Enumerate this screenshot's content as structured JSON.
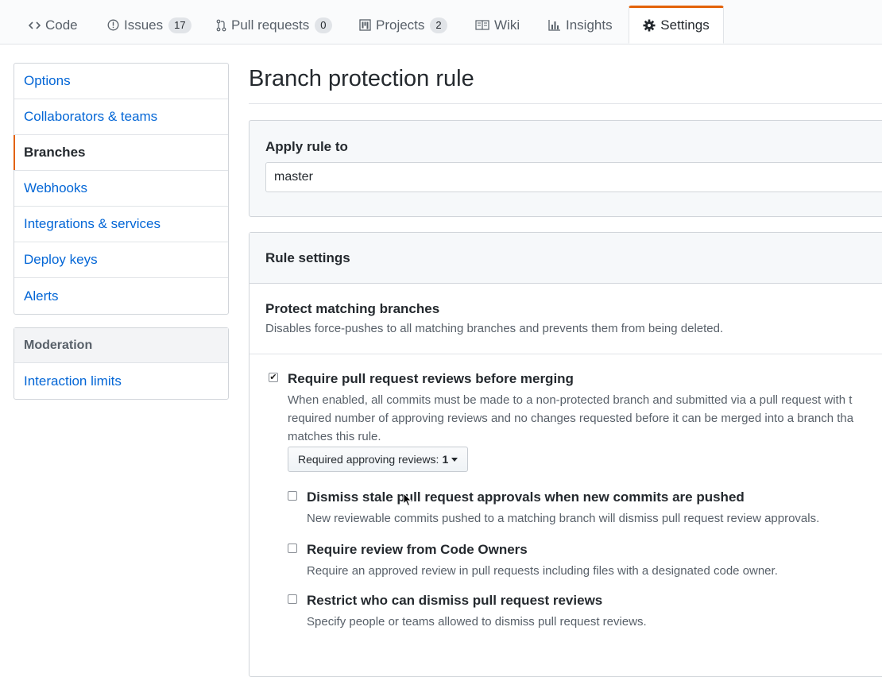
{
  "repo_nav": {
    "tabs": [
      {
        "label": "Code",
        "icon": "code-icon"
      },
      {
        "label": "Issues",
        "icon": "issue-opened-icon",
        "count": "17"
      },
      {
        "label": "Pull requests",
        "icon": "git-pull-request-icon",
        "count": "0"
      },
      {
        "label": "Projects",
        "icon": "project-icon",
        "count": "2"
      },
      {
        "label": "Wiki",
        "icon": "book-icon"
      },
      {
        "label": "Insights",
        "icon": "graph-icon"
      },
      {
        "label": "Settings",
        "icon": "gear-icon",
        "selected": true
      }
    ],
    "accent_color": "#e36209"
  },
  "sidebar": {
    "items": [
      {
        "label": "Options"
      },
      {
        "label": "Collaborators & teams"
      },
      {
        "label": "Branches",
        "selected": true
      },
      {
        "label": "Webhooks"
      },
      {
        "label": "Integrations & services"
      },
      {
        "label": "Deploy keys"
      },
      {
        "label": "Alerts"
      }
    ],
    "moderation": {
      "heading": "Moderation",
      "items": [
        {
          "label": "Interaction limits"
        }
      ]
    },
    "link_color": "#0366d6"
  },
  "main": {
    "title": "Branch protection rule",
    "apply_rule": {
      "label": "Apply rule to",
      "value": "master"
    },
    "rule_settings": {
      "header": "Rule settings",
      "protect": {
        "title": "Protect matching branches",
        "description": "Disables force-pushes to all matching branches and prevents them from being deleted."
      },
      "require_reviews": {
        "checked": true,
        "title": "Require pull request reviews before merging",
        "description_lines": [
          "When enabled, all commits must be made to a non-protected branch and submitted via a pull request with t",
          "required number of approving reviews and no changes requested before it can be merged into a branch tha",
          "matches this rule."
        ],
        "approving_reviews_label": "Required approving reviews:",
        "approving_reviews_value": "1"
      },
      "sub_options": [
        {
          "checked": false,
          "title": "Dismiss stale pull request approvals when new commits are pushed",
          "description": "New reviewable commits pushed to a matching branch will dismiss pull request review approvals."
        },
        {
          "checked": false,
          "title": "Require review from Code Owners",
          "description": "Require an approved review in pull requests including files with a designated code owner."
        },
        {
          "checked": false,
          "title": "Restrict who can dismiss pull request reviews",
          "description": "Specify people or teams allowed to dismiss pull request reviews."
        }
      ]
    }
  }
}
